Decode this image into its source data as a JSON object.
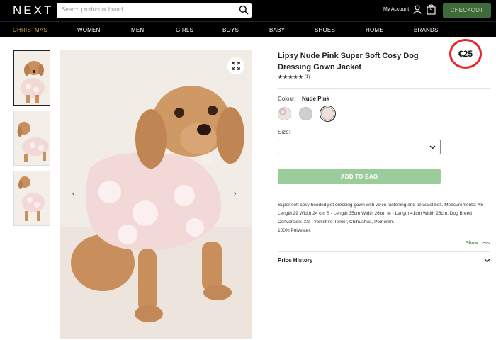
{
  "header": {
    "logo": "NEXT",
    "search_placeholder": "Search product or brand",
    "account_label": "My Account",
    "bag_count": "0",
    "checkout_label": "CHECKOUT"
  },
  "nav": {
    "items": [
      "CHRISTMAS",
      "WOMEN",
      "MEN",
      "GIRLS",
      "BOYS",
      "BABY",
      "SHOES",
      "HOME",
      "BRANDS"
    ]
  },
  "gallery": {
    "thumbnail_count": 3,
    "prev_icon": "chevron-left",
    "next_icon": "chevron-right",
    "expand_icon": "expand"
  },
  "product": {
    "title": "Lipsy Nude Pink Super Soft Cosy Dog Dressing Gown Jacket",
    "price": "€25",
    "rating_stars": "★★★★★",
    "rating_value": 5,
    "rating_count": "(1)",
    "colour_label": "Colour:",
    "colour_value": "Nude Pink",
    "swatches": [
      {
        "name": "pink-pattern",
        "color": "#d9c5c2"
      },
      {
        "name": "grey",
        "color": "#cfcfcf"
      },
      {
        "name": "nude-pink",
        "color": "#efe1d9"
      }
    ],
    "size_label": "Size:",
    "size_value": "",
    "add_to_bag": "ADD TO BAG",
    "add_to_bag_color": "#9bcc9b",
    "description": "Super soft cosy hooded pet dressing gown with velco fastening and tie waist belt. Measurements: XS - Length 29 Width 24 cm S - Length 35cm Width 26cm M - Length 41cm Width 28cm. Dog Breed Conversion: XS - Yorkshire Terrier, Chihuahua, Pomeran.",
    "material": "100% Polyester.",
    "show_less": "Show Less",
    "price_history": "Price History"
  },
  "colors": {
    "header_bg": "#000000",
    "checkout_bg": "#3f6a3a",
    "christmas": "#d4a24c",
    "price_circle": "#e8262a"
  }
}
